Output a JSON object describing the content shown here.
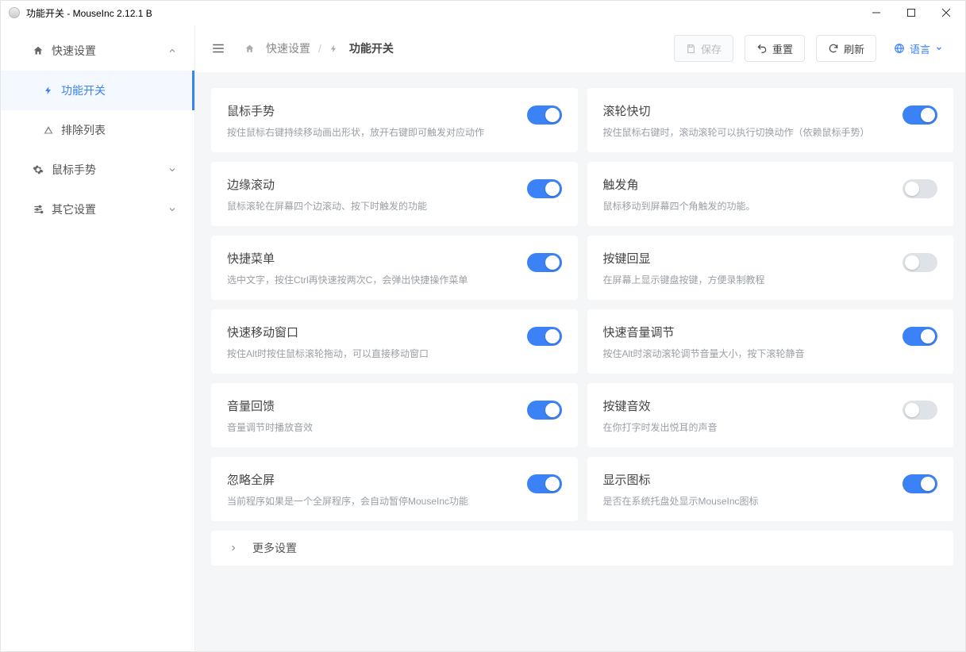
{
  "window_title": "功能开关 - MouseInc 2.12.1 B",
  "breadcrumb_root": "快速设置",
  "breadcrumb_current": "功能开关",
  "buttons": {
    "save": "保存",
    "reset": "重置",
    "refresh": "刷新",
    "language": "语言"
  },
  "sidebar": {
    "group_quick": "快速设置",
    "item_switch": "功能开关",
    "item_exclude": "排除列表",
    "group_gesture": "鼠标手势",
    "group_other": "其它设置"
  },
  "more_label": "更多设置",
  "switches": [
    {
      "title": "鼠标手势",
      "desc": "按住鼠标右键持续移动画出形状，放开右键即可触发对应动作",
      "on": true
    },
    {
      "title": "滚轮快切",
      "desc": "按住鼠标右键时，滚动滚轮可以执行切换动作（依赖鼠标手势）",
      "on": true
    },
    {
      "title": "边缘滚动",
      "desc": "鼠标滚轮在屏幕四个边滚动、按下时触发的功能",
      "on": true
    },
    {
      "title": "触发角",
      "desc": "鼠标移动到屏幕四个角触发的功能。",
      "on": false
    },
    {
      "title": "快捷菜单",
      "desc": "选中文字，按住Ctrl再快速按两次C，会弹出快捷操作菜单",
      "on": true
    },
    {
      "title": "按键回显",
      "desc": "在屏幕上显示键盘按键，方便录制教程",
      "on": false
    },
    {
      "title": "快速移动窗口",
      "desc": "按住Alt时按住鼠标滚轮拖动，可以直接移动窗口",
      "on": true
    },
    {
      "title": "快速音量调节",
      "desc": "按住Alt时滚动滚轮调节音量大小，按下滚轮静音",
      "on": true
    },
    {
      "title": "音量回馈",
      "desc": "音量调节时播放音效",
      "on": true
    },
    {
      "title": "按键音效",
      "desc": "在你打字时发出悦耳的声音",
      "on": false
    },
    {
      "title": "忽略全屏",
      "desc": "当前程序如果是一个全屏程序，会自动暂停MouseInc功能",
      "on": true
    },
    {
      "title": "显示图标",
      "desc": "是否在系统托盘处显示MouseInc图标",
      "on": true
    }
  ]
}
